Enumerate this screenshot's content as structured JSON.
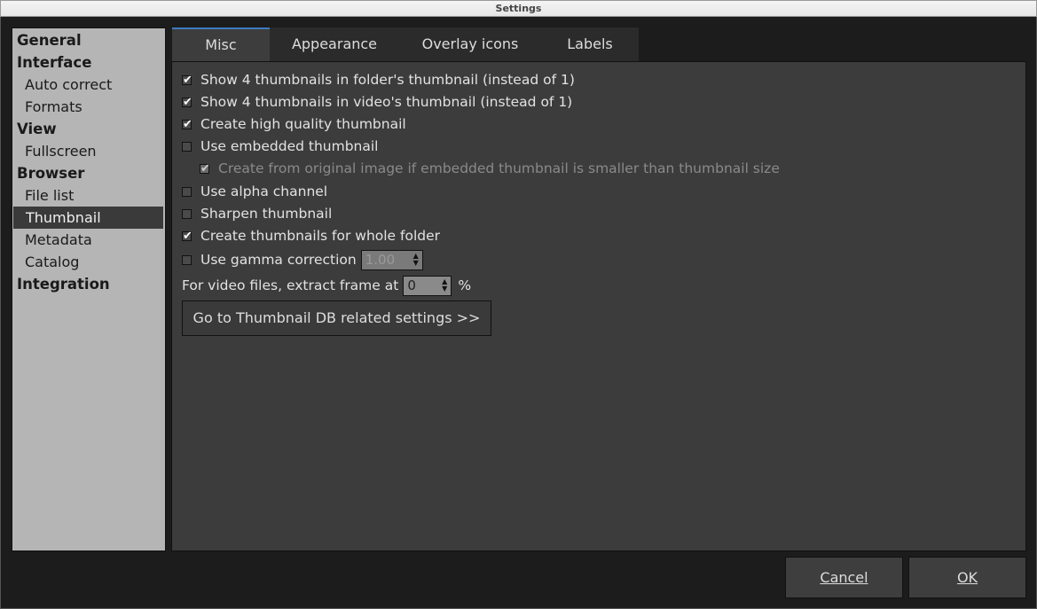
{
  "window": {
    "title": "Settings"
  },
  "sidebar": {
    "items": [
      {
        "label": "General",
        "level": 0
      },
      {
        "label": "Interface",
        "level": 0
      },
      {
        "label": "Auto correct",
        "level": 1
      },
      {
        "label": "Formats",
        "level": 1
      },
      {
        "label": "View",
        "level": 0
      },
      {
        "label": "Fullscreen",
        "level": 1
      },
      {
        "label": "Browser",
        "level": 0
      },
      {
        "label": "File list",
        "level": 1
      },
      {
        "label": "Thumbnail",
        "level": 1,
        "selected": true
      },
      {
        "label": "Metadata",
        "level": 1
      },
      {
        "label": "Catalog",
        "level": 1
      },
      {
        "label": "Integration",
        "level": 0
      }
    ]
  },
  "tabs": [
    {
      "label": "Misc",
      "active": true
    },
    {
      "label": "Appearance"
    },
    {
      "label": "Overlay icons"
    },
    {
      "label": "Labels"
    }
  ],
  "options": [
    {
      "label": "Show 4 thumbnails in folder's thumbnail (instead of 1)",
      "checked": true
    },
    {
      "label": "Show 4 thumbnails in video's thumbnail (instead of 1)",
      "checked": true
    },
    {
      "label": "Create high quality thumbnail",
      "checked": true
    },
    {
      "label": "Use embedded thumbnail",
      "checked": false
    },
    {
      "label": "Create from original image if embedded thumbnail is smaller than thumbnail size",
      "checked": true,
      "disabled": true
    },
    {
      "label": "Use alpha channel",
      "checked": false
    },
    {
      "label": "Sharpen thumbnail",
      "checked": false
    },
    {
      "label": "Create  thumbnails for whole folder",
      "checked": true
    },
    {
      "label": "Use gamma correction",
      "checked": false
    }
  ],
  "gamma_value": "1.00",
  "video_frame": {
    "label": "For video files, extract frame at",
    "value": "0",
    "unit": "%"
  },
  "db_button": "Go to Thumbnail DB related settings >>",
  "footer": {
    "cancel": "Cancel",
    "ok": "OK"
  },
  "check_mark": "✔"
}
